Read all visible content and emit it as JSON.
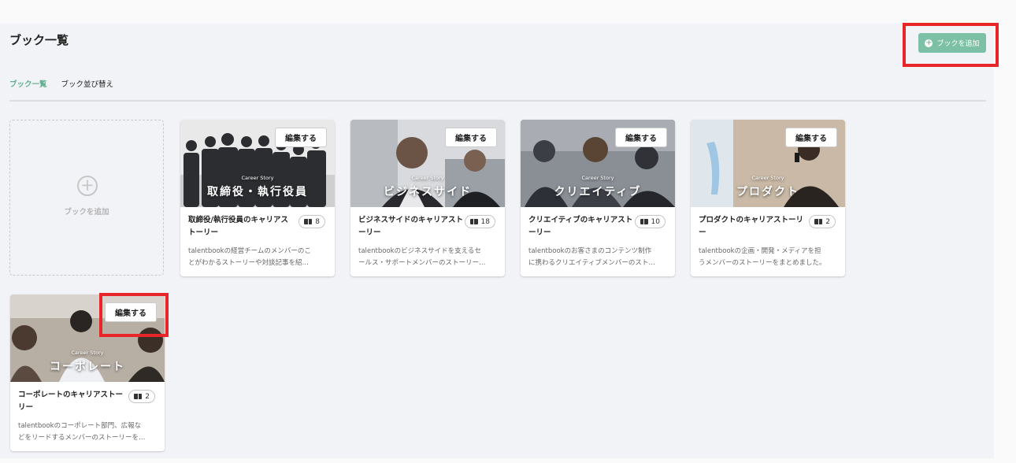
{
  "page": {
    "title": "ブック一覧",
    "add_book_button": "ブックを追加"
  },
  "tabs": [
    {
      "label": "ブック一覧",
      "active": true
    },
    {
      "label": "ブック並び替え",
      "active": false
    }
  ],
  "add_card": {
    "label": "ブックを追加"
  },
  "edit_label": "編集する",
  "cards": [
    {
      "thumb_small": "Career Story",
      "thumb_big": "取締役・執行役員",
      "title": "取締役/執行役員のキャリアストーリー",
      "count": "8",
      "desc1": "talentbookの経営チームのメンバーのこ",
      "desc2": "とがわかるストーリーや対談記事を紹…"
    },
    {
      "thumb_small": "Career Story",
      "thumb_big": "ビジネスサイド",
      "title": "ビジネスサイドのキャリアストーリー",
      "count": "18",
      "desc1": "talentbookのビジネスサイドを支えるセ",
      "desc2": "ールス・サポートメンバーのストーリー…"
    },
    {
      "thumb_small": "Career Story",
      "thumb_big": "クリエイティブ",
      "title": "クリエイティブのキャリアストーリー",
      "count": "10",
      "desc1": "talentbookのお客さまのコンテンツ制作",
      "desc2": "に携わるクリエイティブメンバーのスト…"
    },
    {
      "thumb_small": "Career Story",
      "thumb_big": "プロダクト",
      "title": "プロダクトのキャリアストーリー",
      "count": "2",
      "desc1": "talentbookの企画・開発・メディアを担",
      "desc2": "うメンバーのストーリーをまとめました。"
    },
    {
      "thumb_small": "Career Story",
      "thumb_big": "コーポレート",
      "title": "コーポレートのキャリアストーリー",
      "count": "2",
      "desc1": "talentbookのコーポレート部門、広報な",
      "desc2": "どをリードするメンバーのストーリーを…"
    }
  ]
}
